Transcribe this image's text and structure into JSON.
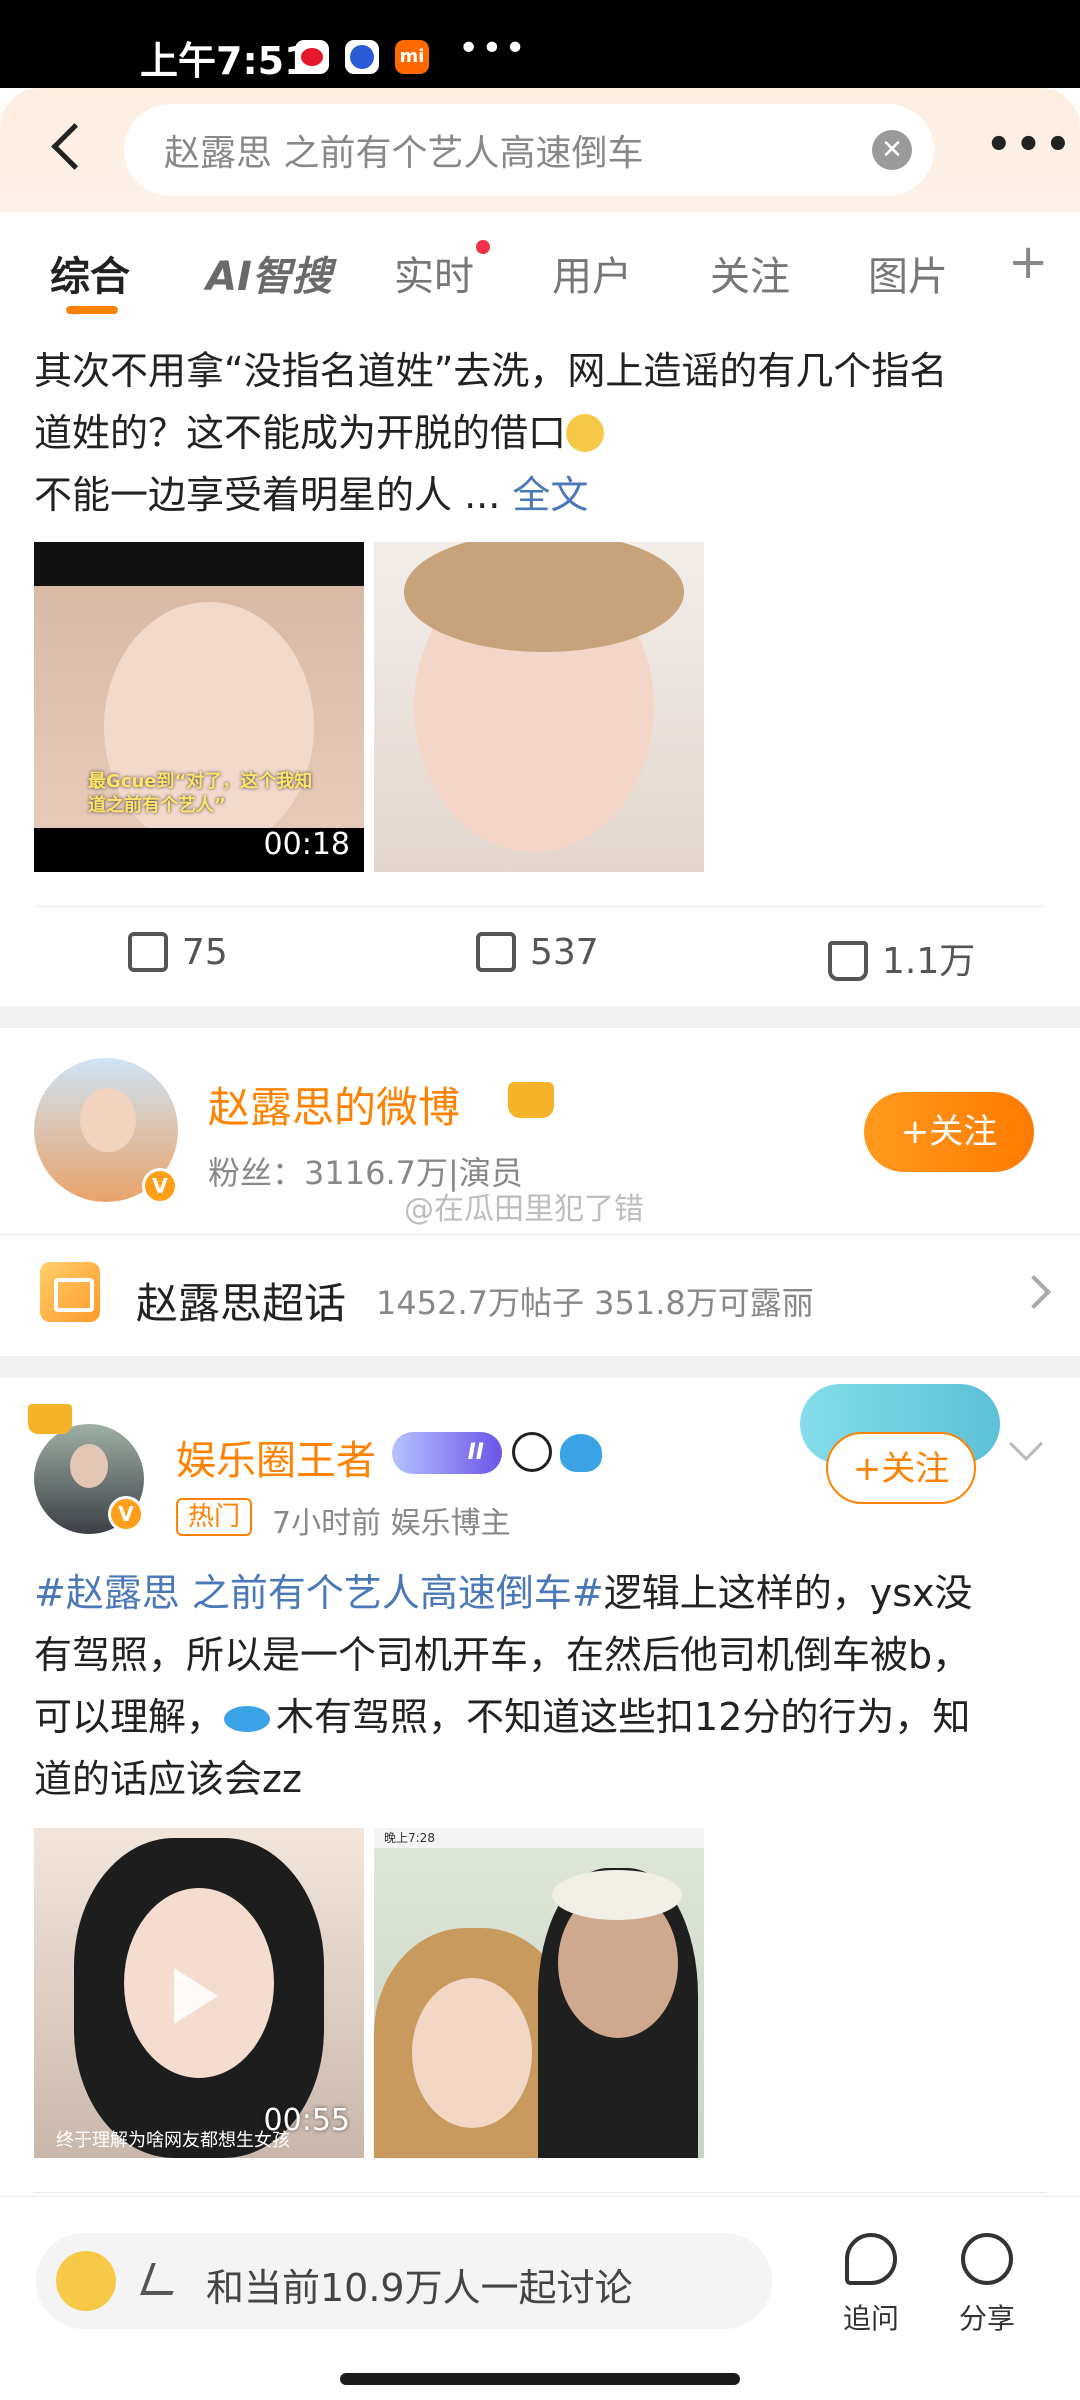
{
  "status_bar": {
    "time": "上午7:51"
  },
  "search": {
    "query": "赵露思 之前有个艺人高速倒车"
  },
  "tabs": [
    {
      "label": "综合"
    },
    {
      "label": "AI智搜"
    },
    {
      "label": "实时"
    },
    {
      "label": "用户"
    },
    {
      "label": "关注"
    },
    {
      "label": "图片"
    }
  ],
  "post1": {
    "line1": "其次不用拿“没指名道姓”去洗，网上造谣的有几个指名",
    "line2": "道姓的？这不能成为开脱的借口",
    "line3": "不能一边享受着明星的人 ... ",
    "fulltext": "全文",
    "video_duration": "00:18",
    "video_caption": "最Gcue到“对了，这个我知道之前有个艺人”",
    "reposts": "75",
    "comments": "537",
    "likes": "1.1万"
  },
  "profile": {
    "name": "赵露思的微博",
    "meta": "粉丝：3116.7万|演员",
    "follow": "+关注"
  },
  "watermark": "@在瓜田里犯了错",
  "topic": {
    "name": "赵露思超话",
    "stats": "1452.7万帖子  351.8万可露丽"
  },
  "post2": {
    "username": "娱乐圈王者",
    "badge": "II",
    "hot_tag": "热门",
    "time": "7小时前  娱乐博主",
    "follow": "+关注",
    "hashtag": "#赵露思 之前有个艺人高速倒车#",
    "text1": "逻辑上这样的，ysx没",
    "line2": "有驾照，所以是一个司机开车，在然后他司机倒车被b，",
    "line3a": "可以理解，",
    "line3b": "木有驾照，不知道这些扣12分的行为，知",
    "line4": "道的话应该会zz",
    "video_duration": "00:55",
    "video_caption": "终于理解为啥网友都想生女孩",
    "photo_status": "晚上7:28"
  },
  "bottom": {
    "discuss": "和当前10.9万人一起讨论",
    "ask": "追问",
    "share": "分享"
  },
  "colors": {
    "accent": "#ff8200",
    "link": "#4a78b8",
    "header_bg": "#fdeee2"
  }
}
